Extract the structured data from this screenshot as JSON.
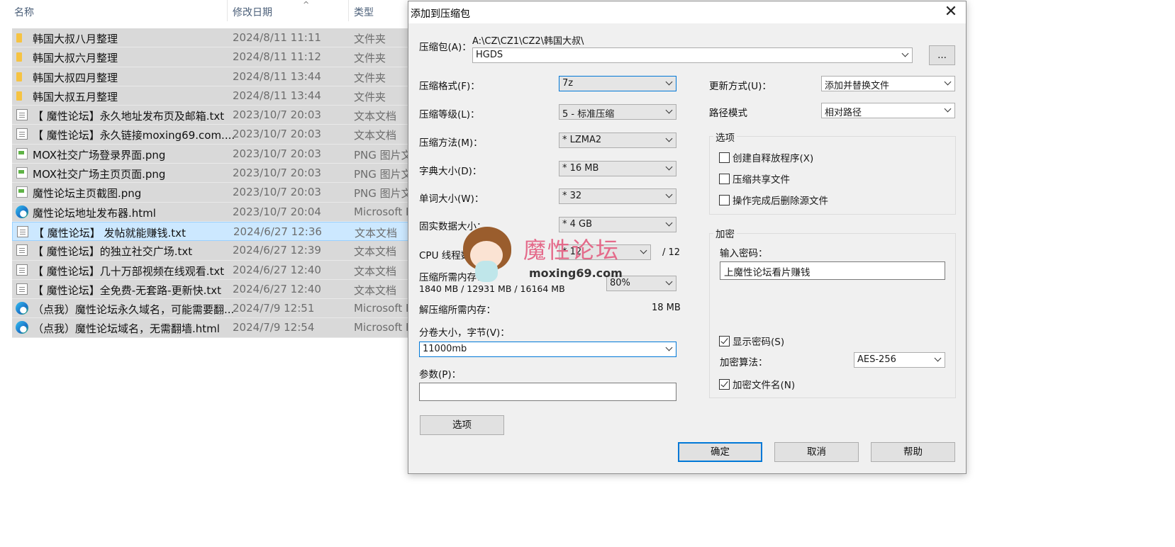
{
  "explorer": {
    "columns": {
      "name": "名称",
      "date": "修改日期",
      "type": "类型"
    },
    "sort_indicator": "^",
    "files": [
      {
        "name": "韩国大叔八月整理",
        "date": "2024/8/11 11:11",
        "type": "文件夹",
        "icon": "folder-icon"
      },
      {
        "name": "韩国大叔六月整理",
        "date": "2024/8/11 11:12",
        "type": "文件夹",
        "icon": "folder-icon"
      },
      {
        "name": "韩国大叔四月整理",
        "date": "2024/8/11 13:44",
        "type": "文件夹",
        "icon": "folder-icon"
      },
      {
        "name": "韩国大叔五月整理",
        "date": "2024/8/11 13:44",
        "type": "文件夹",
        "icon": "folder-icon"
      },
      {
        "name": "【 魔性论坛】永久地址发布页及邮箱.txt",
        "date": "2023/10/7 20:03",
        "type": "文本文档",
        "icon": "text-file-icon"
      },
      {
        "name": "【 魔性论坛】永久链接moxing69.com....",
        "date": "2023/10/7 20:03",
        "type": "文本文档",
        "icon": "text-file-icon"
      },
      {
        "name": "MOX社交广场登录界面.png",
        "date": "2023/10/7 20:03",
        "type": "PNG 图片文件",
        "icon": "image-file-icon"
      },
      {
        "name": "MOX社交广场主页页面.png",
        "date": "2023/10/7 20:03",
        "type": "PNG 图片文件",
        "icon": "image-file-icon"
      },
      {
        "name": "魔性论坛主页截图.png",
        "date": "2023/10/7 20:03",
        "type": "PNG 图片文件",
        "icon": "image-file-icon"
      },
      {
        "name": "魔性论坛地址发布器.html",
        "date": "2023/10/7 20:04",
        "type": "Microsoft Edge",
        "icon": "edge-icon"
      },
      {
        "name": "【 魔性论坛】 发帖就能赚钱.txt",
        "date": "2024/6/27 12:36",
        "type": "文本文档",
        "icon": "text-file-icon",
        "focused": true
      },
      {
        "name": "【 魔性论坛】的独立社交广场.txt",
        "date": "2024/6/27 12:39",
        "type": "文本文档",
        "icon": "text-file-icon"
      },
      {
        "name": "【 魔性论坛】几十万部视频在线观看.txt",
        "date": "2024/6/27 12:40",
        "type": "文本文档",
        "icon": "text-file-icon"
      },
      {
        "name": "【 魔性论坛】全免费-无套路-更新快.txt",
        "date": "2024/6/27 12:40",
        "type": "文本文档",
        "icon": "text-file-icon"
      },
      {
        "name": "（点我）魔性论坛永久域名，可能需要翻...",
        "date": "2024/7/9 12:51",
        "type": "Microsoft Edge",
        "icon": "edge-icon"
      },
      {
        "name": "（点我）魔性论坛域名，无需翻墙.html",
        "date": "2024/7/9 12:54",
        "type": "Microsoft Edge",
        "icon": "edge-icon"
      }
    ]
  },
  "dialog": {
    "title": "添加到压缩包",
    "close_glyph": "✕",
    "archive": {
      "label": "压缩包(A)：",
      "path": "A:\\CZ\\CZ1\\CZ2\\韩国大叔\\",
      "value": "HGDS",
      "browse_label": "..."
    },
    "format": {
      "label": "压缩格式(F)：",
      "value": "7z"
    },
    "level": {
      "label": "压缩等级(L)：",
      "value": "5 - 标准压缩"
    },
    "method": {
      "label": "压缩方法(M)：",
      "value": "* LZMA2"
    },
    "dict": {
      "label": "字典大小(D)：",
      "value": "* 16 MB"
    },
    "word": {
      "label": "单词大小(W)：",
      "value": "* 32"
    },
    "solid": {
      "label": "固实数据大小：",
      "value": "* 4 GB"
    },
    "threads": {
      "label": "CPU 线程数：",
      "value": "* 12",
      "max": "/ 12"
    },
    "mem_compress": {
      "label": "压缩所需内存：",
      "detail": "1840 MB / 12931 MB / 16164 MB",
      "percent": "80%"
    },
    "mem_decompress": {
      "label": "解压缩所需内存：",
      "value": "18 MB"
    },
    "volume": {
      "label": "分卷大小，字节(V)：",
      "value": "11000mb"
    },
    "params": {
      "label": "参数(P)：",
      "value": ""
    },
    "options_button": "选项",
    "update": {
      "label": "更新方式(U)：",
      "value": "添加并替换文件"
    },
    "path_mode": {
      "label": "路径模式",
      "value": "相对路径"
    },
    "options_group": {
      "title": "选项",
      "sfx": {
        "label": "创建自释放程序(X)",
        "checked": false
      },
      "shared": {
        "label": "压缩共享文件",
        "checked": false
      },
      "delete": {
        "label": "操作完成后删除源文件",
        "checked": false
      }
    },
    "encryption": {
      "title": "加密",
      "password_label": "输入密码：",
      "password_value": "上魔性论坛看片赚钱",
      "show_password": {
        "label": "显示密码(S)",
        "checked": true
      },
      "method_label": "加密算法：",
      "method_value": "AES-256",
      "encrypt_names": {
        "label": "加密文件名(N)",
        "checked": true
      }
    },
    "buttons": {
      "ok": "确定",
      "cancel": "取消",
      "help": "帮助"
    }
  },
  "watermark": {
    "title": "魔性论坛",
    "url": "moxing69.com"
  }
}
